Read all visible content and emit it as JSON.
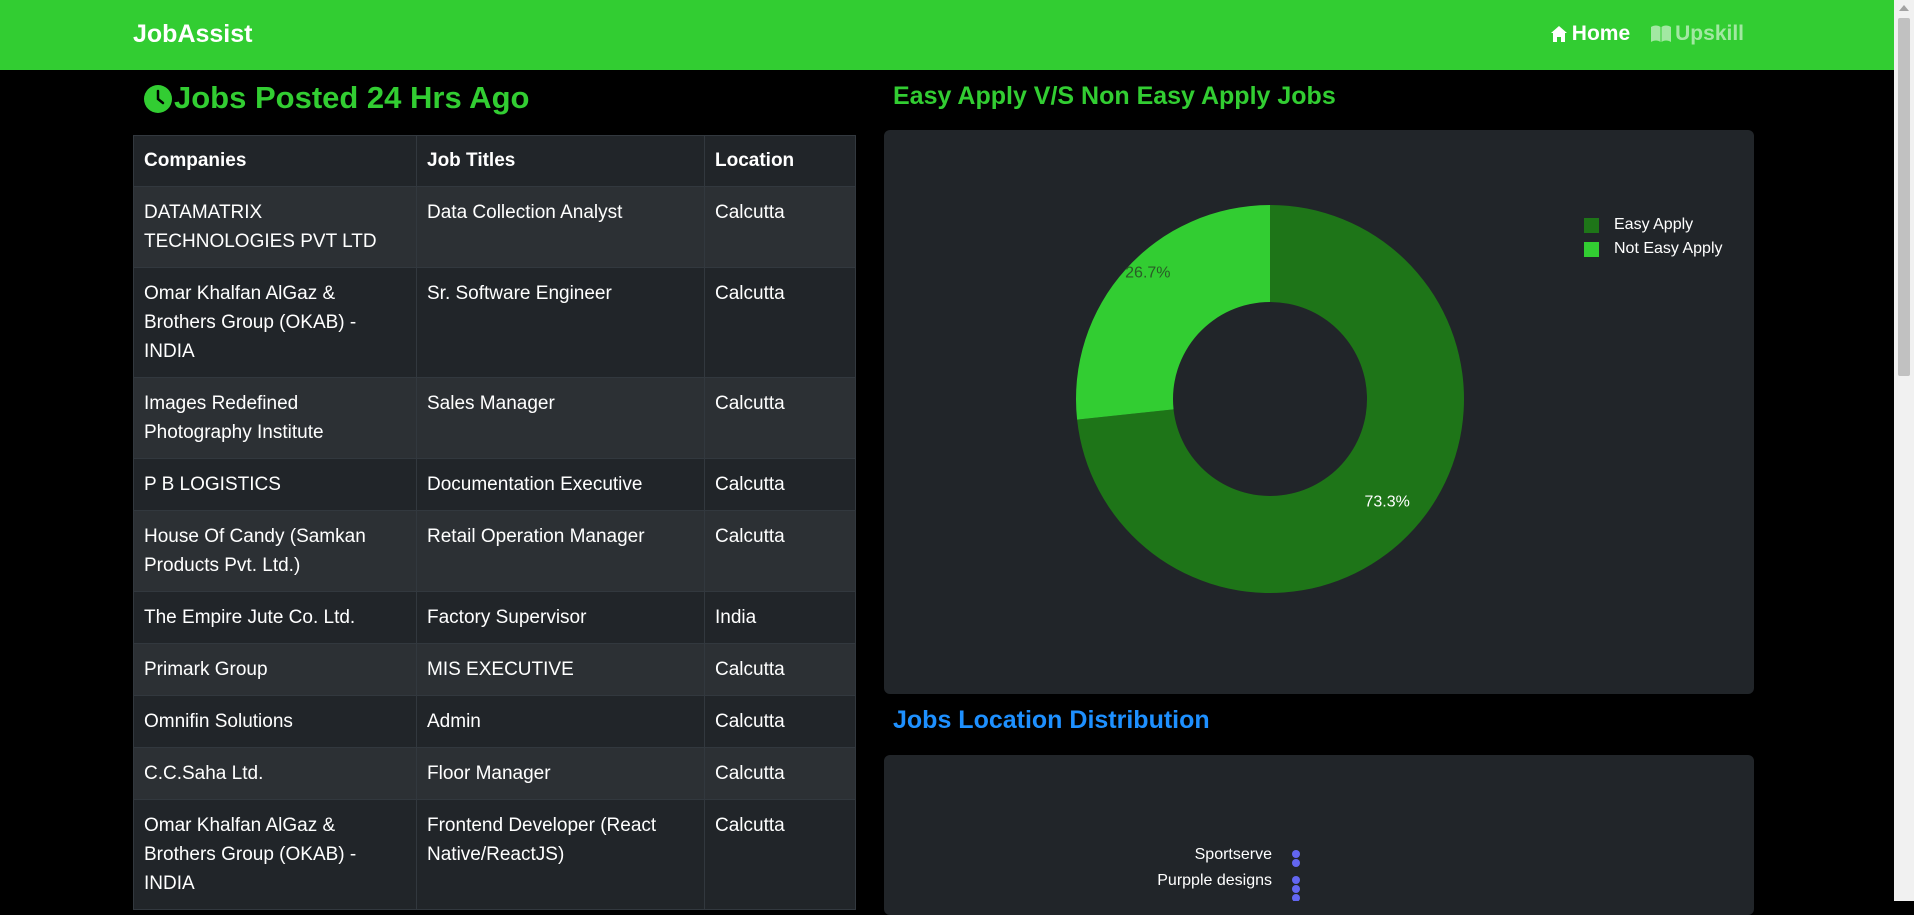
{
  "navbar": {
    "brand": "JobAssist",
    "links": [
      {
        "label": "Home",
        "icon": "home-icon",
        "active": true
      },
      {
        "label": "Upskill",
        "icon": "book-icon",
        "active": false
      }
    ],
    "color": "#32cd32"
  },
  "jobs_section": {
    "title": "Jobs Posted 24 Hrs Ago",
    "icon": "clock-icon",
    "columns": [
      "Companies",
      "Job Titles",
      "Location"
    ],
    "rows": [
      {
        "company": "DATAMATRIX TECHNOLOGIES PVT LTD",
        "title": "Data Collection Analyst",
        "location": "Calcutta"
      },
      {
        "company": "Omar Khalfan AlGaz & Brothers Group (OKAB) - INDIA",
        "title": "Sr. Software Engineer",
        "location": "Calcutta"
      },
      {
        "company": "Images Redefined Photography Institute",
        "title": "Sales Manager",
        "location": "Calcutta"
      },
      {
        "company": "P B LOGISTICS",
        "title": "Documentation Executive",
        "location": "Calcutta"
      },
      {
        "company": "House Of Candy (Samkan Products Pvt. Ltd.)",
        "title": "Retail Operation Manager",
        "location": "Calcutta"
      },
      {
        "company": "The Empire Jute Co. Ltd.",
        "title": "Factory Supervisor",
        "location": "India"
      },
      {
        "company": "Primark Group",
        "title": "MIS EXECUTIVE",
        "location": "Calcutta"
      },
      {
        "company": "Omnifin Solutions",
        "title": "Admin",
        "location": "Calcutta"
      },
      {
        "company": "C.C.Saha Ltd.",
        "title": "Floor Manager",
        "location": "Calcutta"
      },
      {
        "company": "Omar Khalfan AlGaz & Brothers Group (OKAB) - INDIA",
        "title": "Frontend Developer (React Native/ReactJS)",
        "location": "Calcutta"
      }
    ]
  },
  "easy_apply_section": {
    "title": "Easy Apply V/S Non Easy Apply Jobs",
    "title_color": "#32cd32"
  },
  "location_section": {
    "title": "Jobs Location Distribution",
    "title_color": "#1e90ff",
    "visible_labels": [
      "Sportserve",
      "Purpple designs"
    ],
    "dot_color": "#6366f1"
  },
  "chart_data": [
    {
      "type": "pie",
      "style": "donut",
      "categories": [
        "Easy Apply",
        "Not Easy Apply"
      ],
      "values": [
        73.3,
        26.7
      ],
      "value_labels": [
        "73.3%",
        "26.7%"
      ],
      "colors": [
        "#1e7518",
        "#32cd32"
      ],
      "legend_position": "top-right"
    }
  ]
}
